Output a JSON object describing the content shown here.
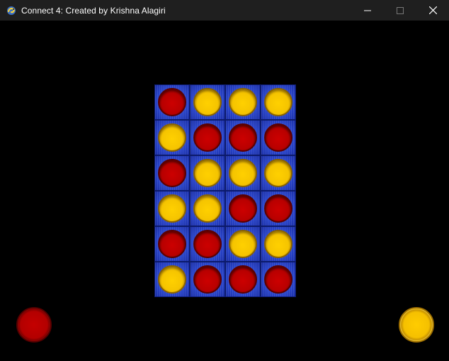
{
  "window": {
    "title": "Connect 4: Created by Krishna Alagiri",
    "icon": "pygame-snake-icon",
    "controls": [
      "minimize-icon",
      "maximize-icon",
      "close-icon"
    ]
  },
  "board": {
    "columns": 4,
    "rows": 6,
    "cells": [
      [
        "red",
        "yellow",
        "yellow",
        "yellow"
      ],
      [
        "yellow",
        "red",
        "red",
        "red"
      ],
      [
        "red",
        "yellow",
        "yellow",
        "yellow"
      ],
      [
        "yellow",
        "yellow",
        "red",
        "red"
      ],
      [
        "red",
        "red",
        "yellow",
        "yellow"
      ],
      [
        "yellow",
        "red",
        "red",
        "red"
      ]
    ]
  },
  "players": {
    "left_token": "red",
    "right_token": "yellow"
  },
  "colors": {
    "background": "#000000",
    "board_blue": "#2a47d0",
    "red": "#c40000",
    "yellow": "#ffcc00",
    "titlebar": "#1f1f1f"
  }
}
